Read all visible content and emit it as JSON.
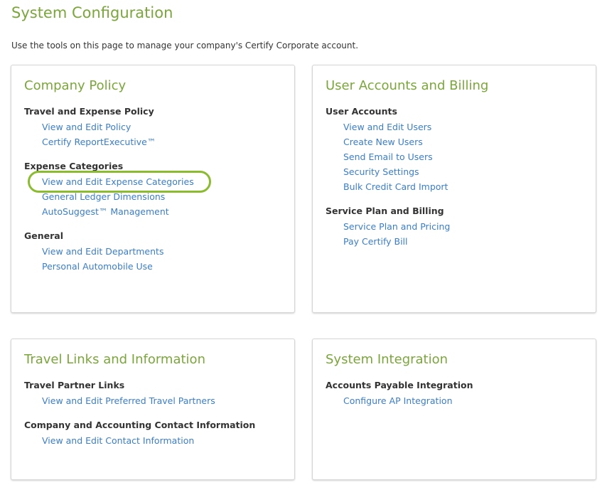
{
  "page": {
    "title": "System Configuration",
    "intro": "Use the tools on this page to manage your company's Certify Corporate account."
  },
  "panels": {
    "company_policy": {
      "title": "Company Policy",
      "sections": [
        {
          "heading": "Travel and Expense Policy",
          "links": [
            "View and Edit Policy",
            "Certify ReportExecutive™"
          ]
        },
        {
          "heading": "Expense Categories",
          "links": [
            "View and Edit Expense Categories",
            "General Ledger Dimensions",
            "AutoSuggest™ Management"
          ]
        },
        {
          "heading": "General",
          "links": [
            "View and Edit Departments",
            "Personal Automobile Use"
          ]
        }
      ]
    },
    "user_accounts": {
      "title": "User Accounts and Billing",
      "sections": [
        {
          "heading": "User Accounts",
          "links": [
            "View and Edit Users",
            "Create New Users",
            "Send Email to Users",
            "Security Settings",
            "Bulk Credit Card Import"
          ]
        },
        {
          "heading": "Service Plan and Billing",
          "links": [
            "Service Plan and Pricing",
            "Pay Certify Bill"
          ]
        }
      ]
    },
    "travel_links": {
      "title": "Travel Links and Information",
      "sections": [
        {
          "heading": "Travel Partner Links",
          "links": [
            "View and Edit Preferred Travel Partners"
          ]
        },
        {
          "heading": "Company and Accounting Contact Information",
          "links": [
            "View and Edit Contact Information"
          ]
        }
      ]
    },
    "system_integration": {
      "title": "System Integration",
      "sections": [
        {
          "heading": "Accounts Payable Integration",
          "links": [
            "Configure AP Integration"
          ]
        }
      ]
    }
  },
  "colors": {
    "accent": "#7ba63a",
    "link": "#3a7ec9",
    "highlight_ring": "#8bbb2f"
  }
}
